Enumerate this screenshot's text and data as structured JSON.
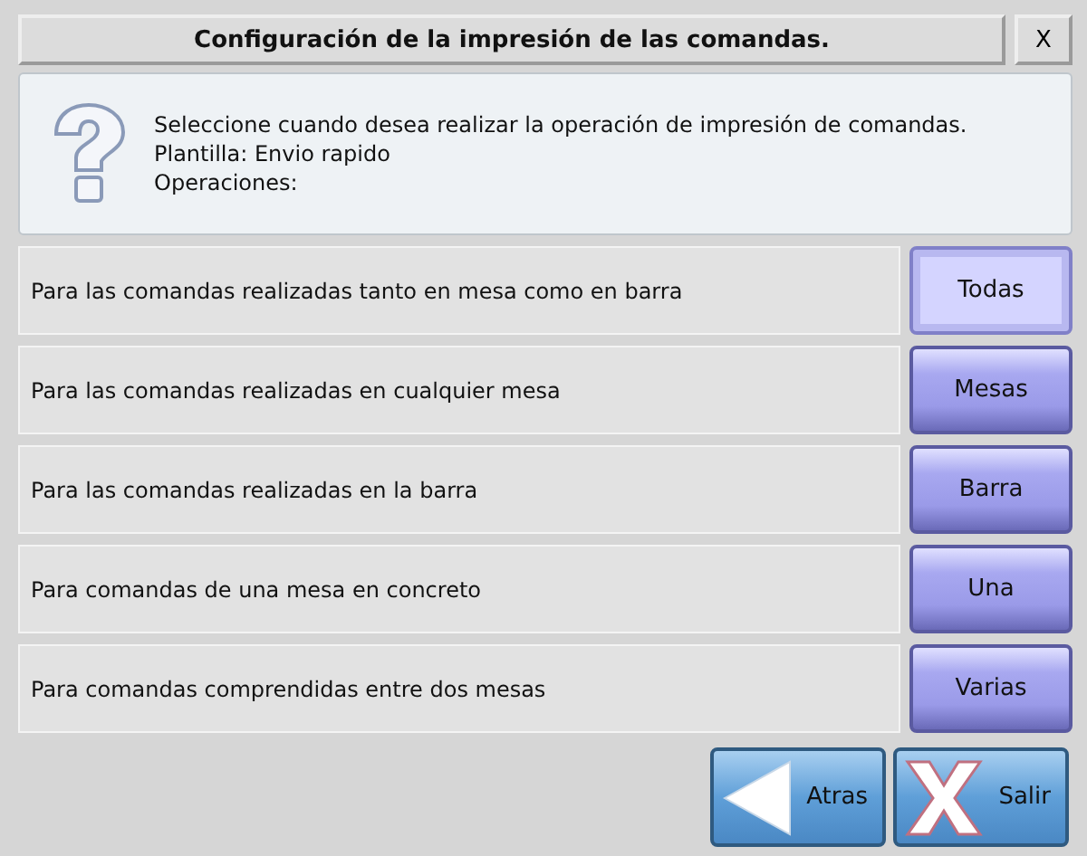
{
  "window": {
    "title": "Configuración de la impresión de las comandas.",
    "close": "X"
  },
  "info": {
    "lines": [
      "Seleccione cuando desea realizar la operación de impresión de comandas.",
      "Plantilla: Envio rapido",
      "Operaciones:"
    ]
  },
  "options": [
    {
      "label": "Para las comandas realizadas tanto en mesa como en barra",
      "button": "Todas",
      "selected": true
    },
    {
      "label": "Para las comandas realizadas en  cualquier mesa",
      "button": "Mesas",
      "selected": false
    },
    {
      "label": "Para las comandas realizadas en la barra",
      "button": "Barra",
      "selected": false
    },
    {
      "label": "Para comandas de una mesa en concreto",
      "button": "Una",
      "selected": false
    },
    {
      "label": "Para comandas comprendidas entre dos mesas",
      "button": "Varias",
      "selected": false
    }
  ],
  "footer": {
    "back": "Atras",
    "exit": "Salir"
  }
}
